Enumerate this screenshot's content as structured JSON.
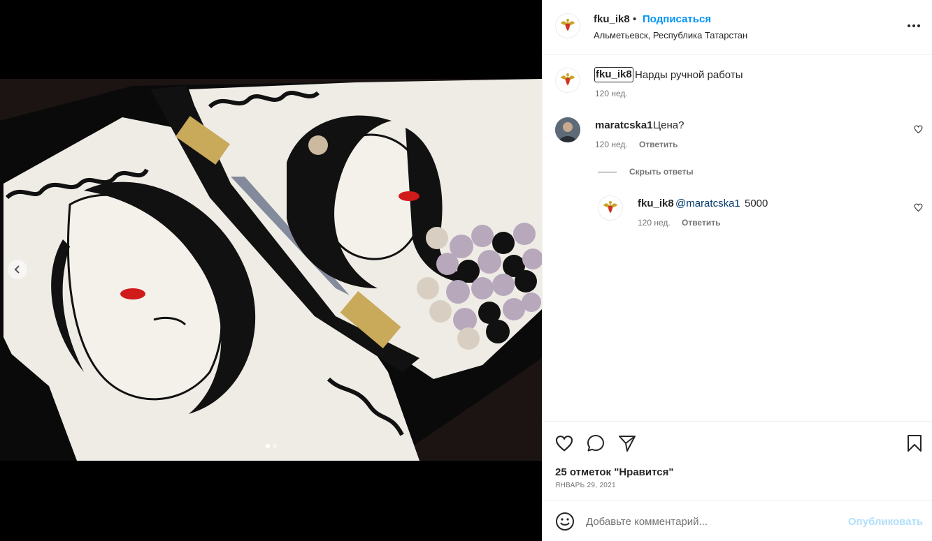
{
  "header": {
    "username": "fku_ik8",
    "separator": "•",
    "follow_label": "Подписаться",
    "location": "Альметьевск, Республика Татарстан",
    "more_icon": "more-horizontal-icon"
  },
  "caption": {
    "username": "fku_ik8",
    "text": "Нарды ручной работы",
    "time": "120 нед."
  },
  "comments": [
    {
      "username": "maratcska1",
      "text": "Цена?",
      "time": "120 нед.",
      "reply_label": "Ответить",
      "hide_replies_label": "Скрыть ответы",
      "replies": [
        {
          "username": "fku_ik8",
          "mention": "@maratcska1",
          "text": "5000",
          "time": "120 нед.",
          "reply_label": "Ответить"
        }
      ]
    }
  ],
  "actions": {
    "icons": [
      "heart-icon",
      "comment-icon",
      "share-icon",
      "bookmark-icon"
    ],
    "likes": "25 отметок \"Нравится\"",
    "date": "ЯНВАРЬ 29, 2021"
  },
  "add_comment": {
    "placeholder": "Добавьте комментарий...",
    "publish_label": "Опубликовать"
  },
  "media": {
    "carousel_slide": 1,
    "carousel_total": 2
  },
  "colors": {
    "accent": "#0095f6",
    "text": "#262626",
    "secondary": "#737373",
    "mention": "#00376b",
    "publish_disabled": "#b2dffc"
  }
}
